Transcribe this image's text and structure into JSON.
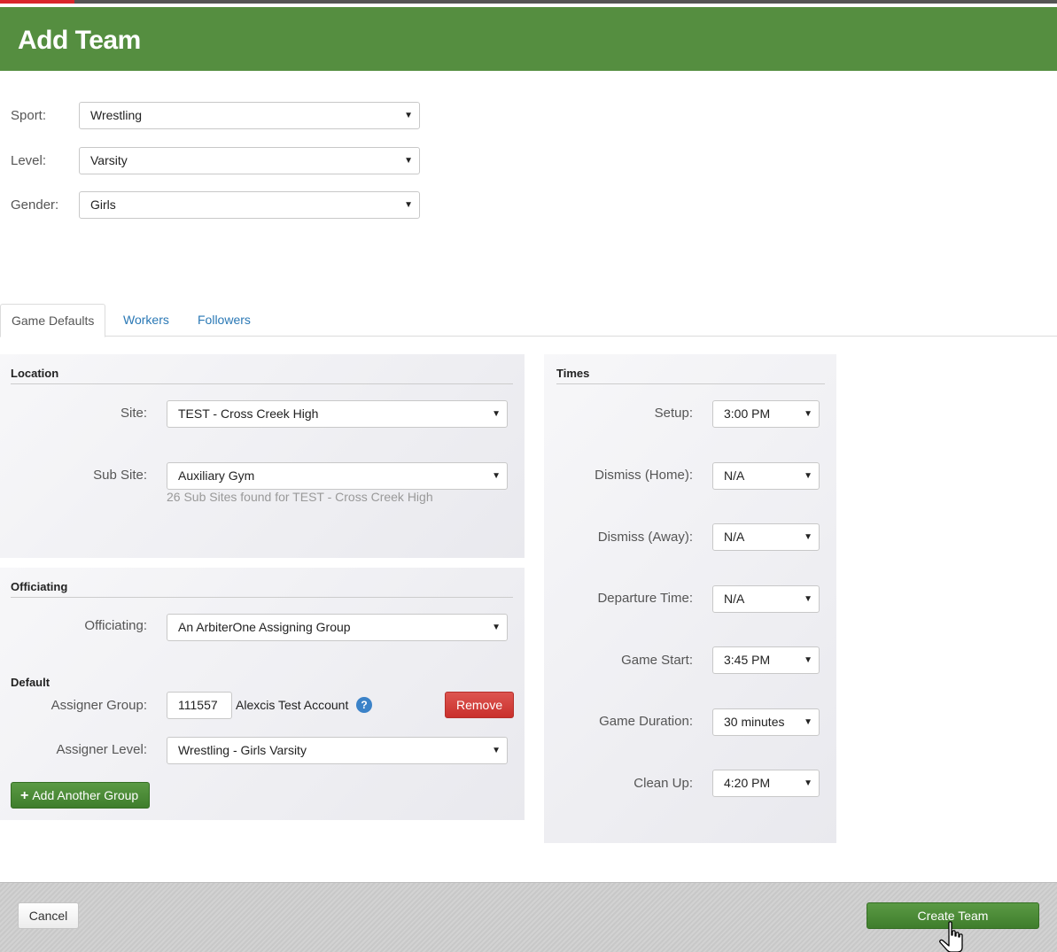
{
  "header": {
    "title": "Add Team"
  },
  "team": {
    "sport": {
      "label": "Sport:",
      "value": "Wrestling"
    },
    "level": {
      "label": "Level:",
      "value": "Varsity"
    },
    "gender": {
      "label": "Gender:",
      "value": "Girls"
    }
  },
  "tabs": [
    {
      "label": "Game Defaults"
    },
    {
      "label": "Workers"
    },
    {
      "label": "Followers"
    }
  ],
  "location": {
    "title": "Location",
    "site": {
      "label": "Site:",
      "value": "TEST - Cross Creek High"
    },
    "sub_site": {
      "label": "Sub Site:",
      "value": "Auxiliary Gym",
      "hint": "26 Sub Sites found for TEST - Cross Creek High"
    }
  },
  "officiating": {
    "title": "Officiating",
    "officiating": {
      "label": "Officiating:",
      "value": "An ArbiterOne Assigning Group"
    },
    "default_title": "Default",
    "assigner_group": {
      "label": "Assigner Group:",
      "value": "111557",
      "account": "Alexcis Test Account",
      "help": "?"
    },
    "remove_label": "Remove",
    "assigner_level": {
      "label": "Assigner Level:",
      "value": "Wrestling - Girls Varsity"
    },
    "add_group_label": "Add Another Group",
    "add_icon": "+"
  },
  "times": {
    "title": "Times",
    "setup": {
      "label": "Setup:",
      "value": "3:00 PM"
    },
    "dismiss_home": {
      "label": "Dismiss (Home):",
      "value": "N/A"
    },
    "dismiss_away": {
      "label": "Dismiss (Away):",
      "value": "N/A"
    },
    "departure": {
      "label": "Departure Time:",
      "value": "N/A"
    },
    "game_start": {
      "label": "Game Start:",
      "value": "3:45 PM"
    },
    "game_duration": {
      "label": "Game Duration:",
      "value": "30 minutes"
    },
    "clean_up": {
      "label": "Clean Up:",
      "value": "4:20 PM"
    }
  },
  "footer": {
    "cancel_label": "Cancel",
    "create_label": "Create Team"
  },
  "colors": {
    "header": "#558e40",
    "primary_button": "#4a8a36",
    "danger_button": "#d43f3a",
    "link": "#2a78b5",
    "accent_red": "#d9262c"
  },
  "icons": {
    "dropdown": "caret-down-icon",
    "help": "question-circle-icon",
    "cursor": "hand-pointer-icon"
  }
}
